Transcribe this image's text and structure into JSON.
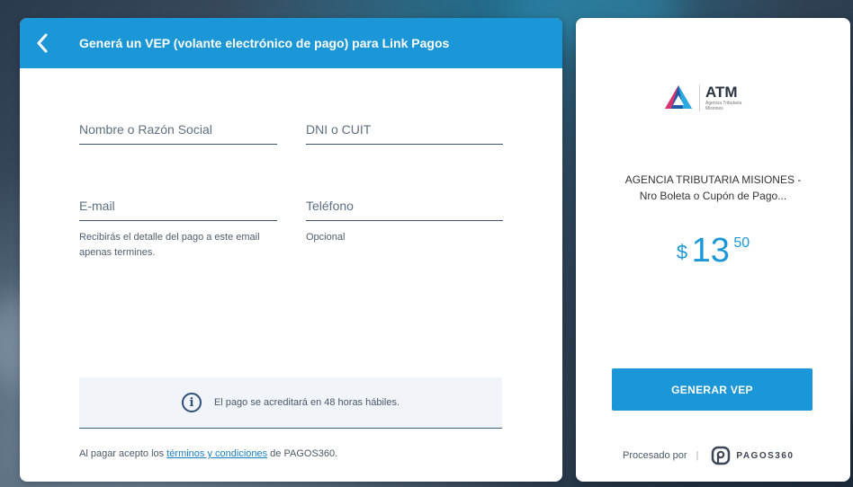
{
  "form": {
    "title": "Generá un VEP (volante electrónico de pago) para Link Pagos",
    "fields": {
      "name_placeholder": "Nombre o Razón Social",
      "dni_placeholder": "DNI o CUIT",
      "email_placeholder": "E-mail",
      "phone_placeholder": "Teléfono"
    },
    "email_helper": "Recibirás el detalle del pago a este email apenas termines.",
    "phone_helper": "Opcional",
    "info_text": "El pago se acreditará en 48 horas hábiles.",
    "terms_prefix": "Al pagar acepto los ",
    "terms_link": "términos y condiciones",
    "terms_suffix": " de PAGOS360."
  },
  "summary": {
    "logo_title": "ATM",
    "logo_subtitle_line1": "Agencia Tributaria",
    "logo_subtitle_line2": "Misiones",
    "merchant_line1": "AGENCIA TRIBUTARIA MISIONES -",
    "merchant_line2": "Nro Boleta o Cupón de Pago...",
    "currency": "$",
    "amount_int": "13",
    "amount_dec": "50",
    "button_label": "GENERAR VEP",
    "processed_by": "Procesado por",
    "separator": "|",
    "provider": "PAGOS360"
  },
  "colors": {
    "accent": "#1b96d6",
    "link": "#1b7fc2"
  },
  "icons": {
    "back": "chevron-left-icon",
    "info": "info-icon",
    "logo": "atm-logo-icon",
    "provider": "pagos360-logo-icon"
  }
}
